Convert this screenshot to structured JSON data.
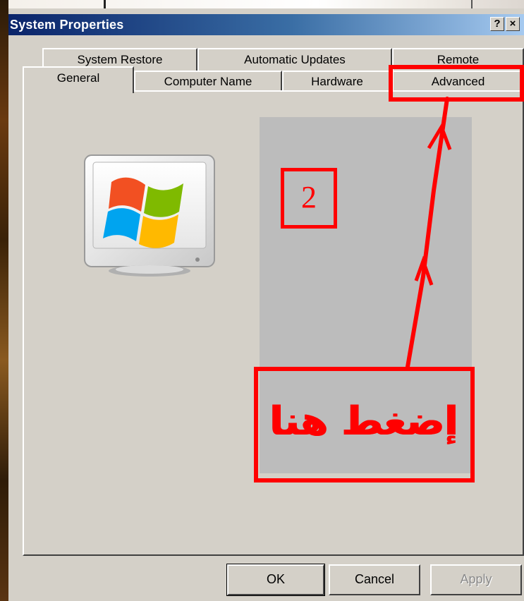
{
  "window": {
    "title": "System Properties",
    "help_label": "?",
    "close_label": "×"
  },
  "tabs": {
    "row_back": [
      "System Restore",
      "Automatic Updates",
      "Remote"
    ],
    "row_front": [
      "General",
      "Computer Name",
      "Hardware",
      "Advanced"
    ],
    "selected": "General"
  },
  "annotation": {
    "step_number": "2",
    "hint": "إضغط هنا",
    "color": "#ff0000"
  },
  "buttons": {
    "ok": "OK",
    "cancel": "Cancel",
    "apply": "Apply"
  },
  "icons": {
    "system": "windows-xp-monitor-icon"
  }
}
